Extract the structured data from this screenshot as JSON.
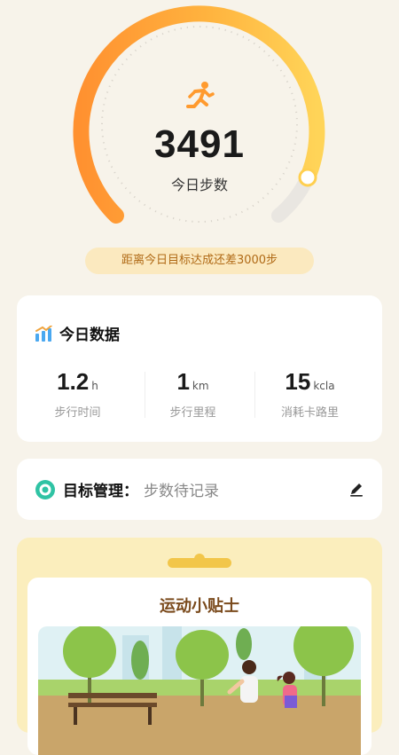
{
  "steps": {
    "value": "3491",
    "label": "今日步数"
  },
  "goal_gap_text": "距离今日目标达成还差3000步",
  "today": {
    "title": "今日数据",
    "stats": [
      {
        "value": "1.2",
        "unit": "h",
        "label": "步行时间"
      },
      {
        "value": "1",
        "unit": "km",
        "label": "步行里程"
      },
      {
        "value": "15",
        "unit": "kcla",
        "label": "消耗卡路里"
      }
    ]
  },
  "goal_manage": {
    "label": "目标管理：",
    "value": "步数待记录"
  },
  "tips": {
    "title": "运动小贴士"
  },
  "colors": {
    "accent_orange": "#ff9a2e",
    "accent_yellow": "#ffd152",
    "goal_text": "#b06a16"
  },
  "icons": [
    "runner-icon",
    "bar-chart-icon",
    "target-icon",
    "edit-pen-icon"
  ]
}
